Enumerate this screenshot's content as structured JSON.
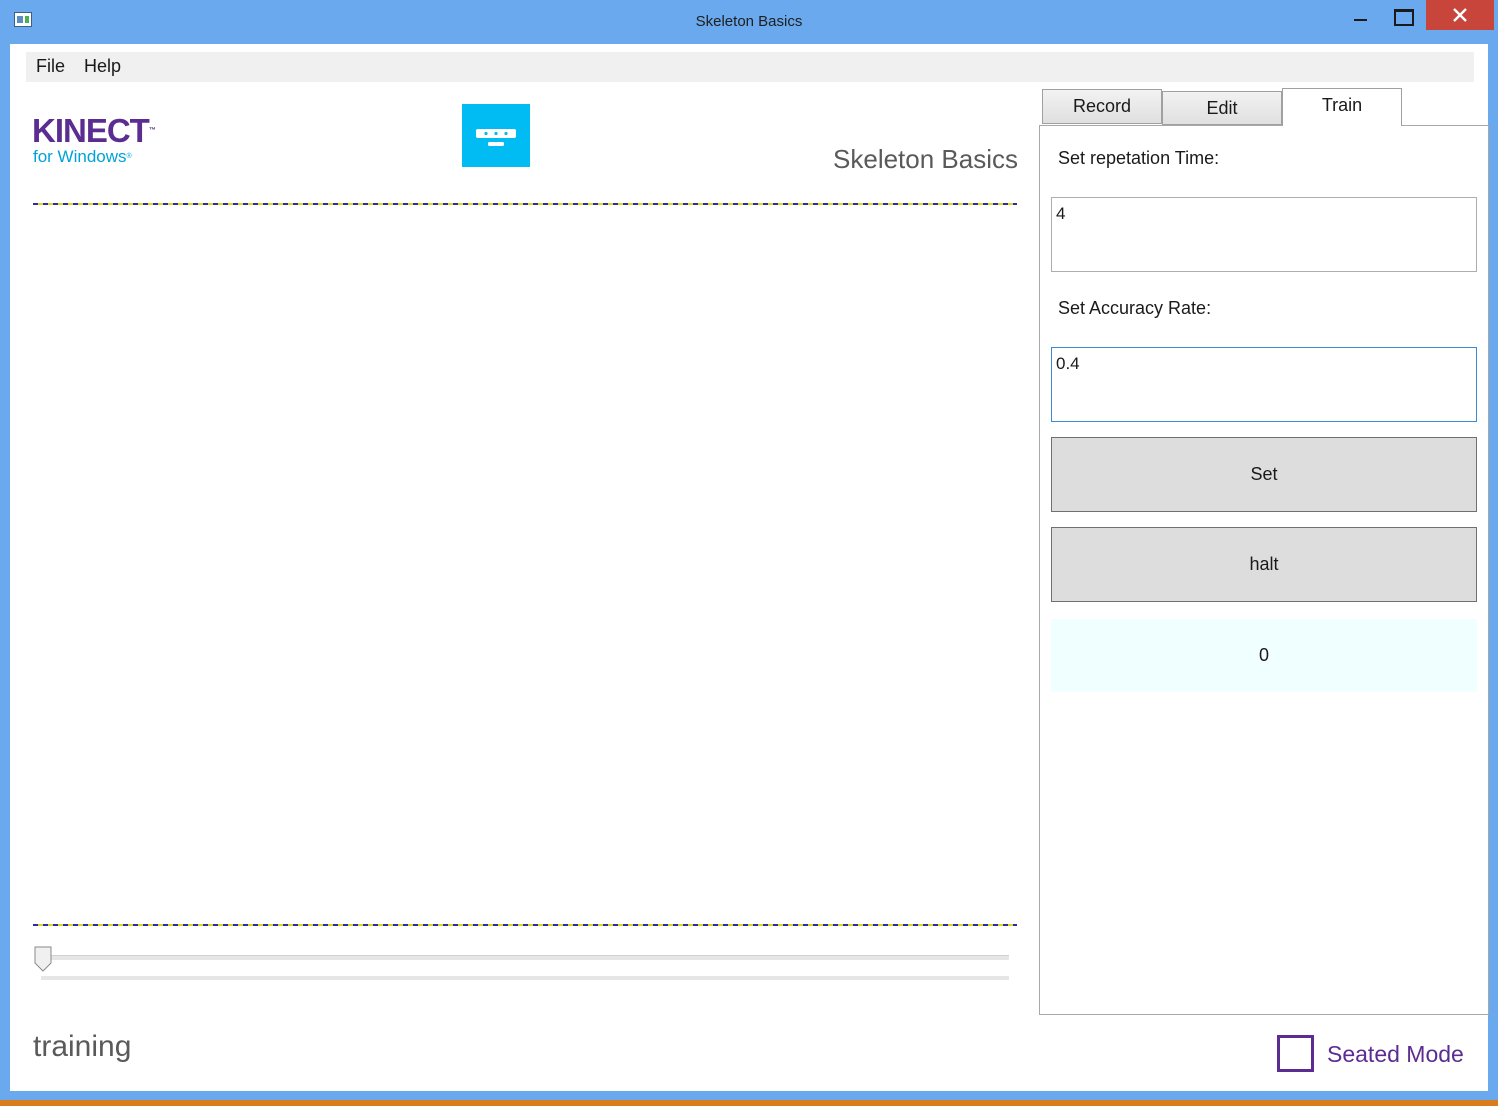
{
  "window": {
    "title": "Skeleton Basics"
  },
  "menu": {
    "file_label": "File",
    "help_label": "Help"
  },
  "branding": {
    "logo_word": "KINECT",
    "logo_tm": "™",
    "logo_sub": "for Windows",
    "logo_sub_tm": "®",
    "heading": "Skeleton Basics"
  },
  "tabs": [
    {
      "label": "Record",
      "selected": false
    },
    {
      "label": "Edit",
      "selected": false
    },
    {
      "label": "Train",
      "selected": true
    }
  ],
  "train": {
    "repetition_label": "Set repetation Time:",
    "repetition_value": "4",
    "accuracy_label": "Set Accuracy Rate:",
    "accuracy_value": "0.4",
    "set_button": "Set",
    "halt_button": "halt",
    "counter": "0"
  },
  "status": {
    "text": "training"
  },
  "seated_mode": {
    "label": "Seated Mode",
    "checked": false
  },
  "slider": {
    "value": 0
  },
  "colors": {
    "kinect_purple": "#5c2d91",
    "kinect_blue": "#00a2d9",
    "sensor_tile": "#00bcf2",
    "title_bar": "#6aa9ee",
    "close_red": "#c7453b"
  }
}
